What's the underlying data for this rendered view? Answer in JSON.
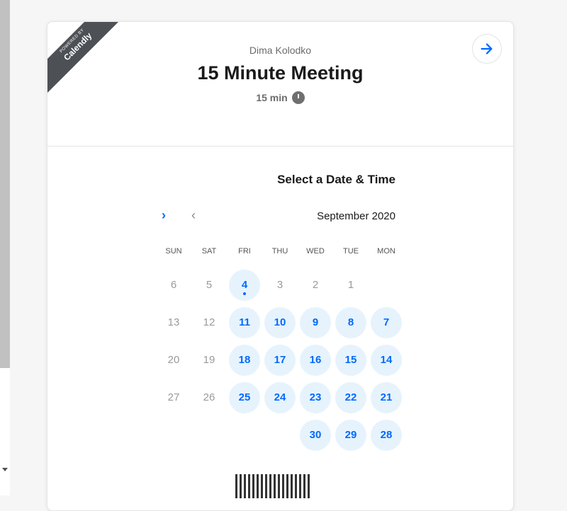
{
  "badge": {
    "powered_by": "POWERED BY",
    "brand": "Calendly"
  },
  "event": {
    "host": "Dima Kolodko",
    "title": "15 Minute Meeting",
    "duration": "15 min"
  },
  "scheduler": {
    "section_title": "Select a Date & Time",
    "month": "September 2020"
  },
  "weekdays": [
    "SUN",
    "SAT",
    "FRI",
    "THU",
    "WED",
    "TUE",
    "MON"
  ],
  "calendar_rows": [
    [
      {
        "d": "6",
        "s": "unavail"
      },
      {
        "d": "5",
        "s": "unavail"
      },
      {
        "d": "4",
        "s": "avail"
      },
      {
        "d": "3",
        "s": "unavail"
      },
      {
        "d": "2",
        "s": "unavail"
      },
      {
        "d": "1",
        "s": "unavail"
      },
      {
        "d": "",
        "s": "empty"
      }
    ],
    [
      {
        "d": "13",
        "s": "unavail"
      },
      {
        "d": "12",
        "s": "unavail"
      },
      {
        "d": "11",
        "s": "avail"
      },
      {
        "d": "10",
        "s": "avail"
      },
      {
        "d": "9",
        "s": "avail"
      },
      {
        "d": "8",
        "s": "avail"
      },
      {
        "d": "7",
        "s": "avail"
      }
    ],
    [
      {
        "d": "20",
        "s": "unavail"
      },
      {
        "d": "19",
        "s": "unavail"
      },
      {
        "d": "18",
        "s": "avail"
      },
      {
        "d": "17",
        "s": "avail"
      },
      {
        "d": "16",
        "s": "avail"
      },
      {
        "d": "15",
        "s": "avail"
      },
      {
        "d": "14",
        "s": "avail"
      }
    ],
    [
      {
        "d": "27",
        "s": "unavail"
      },
      {
        "d": "26",
        "s": "unavail"
      },
      {
        "d": "25",
        "s": "avail"
      },
      {
        "d": "24",
        "s": "avail"
      },
      {
        "d": "23",
        "s": "avail"
      },
      {
        "d": "22",
        "s": "avail"
      },
      {
        "d": "21",
        "s": "avail"
      }
    ],
    [
      {
        "d": "",
        "s": "empty"
      },
      {
        "d": "",
        "s": "empty"
      },
      {
        "d": "",
        "s": "empty"
      },
      {
        "d": "",
        "s": "empty"
      },
      {
        "d": "30",
        "s": "avail"
      },
      {
        "d": "29",
        "s": "avail"
      },
      {
        "d": "28",
        "s": "avail"
      }
    ]
  ],
  "colors": {
    "accent": "#0069ff",
    "available_bg": "#e6f3fd",
    "badge_bg": "#4d5055"
  },
  "icons": {
    "next_arrow": "arrow-right-icon",
    "clock": "clock-icon"
  }
}
